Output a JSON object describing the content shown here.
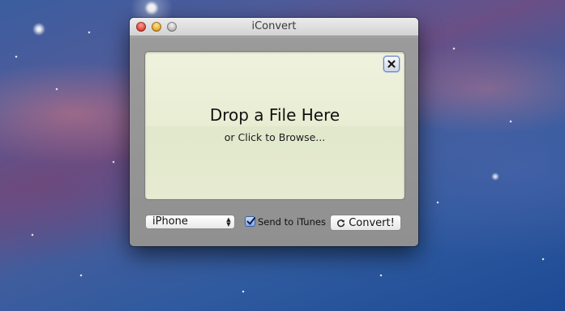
{
  "window": {
    "title": "iConvert",
    "controls": [
      "close",
      "minimize",
      "zoom"
    ]
  },
  "dropzone": {
    "title": "Drop a File Here",
    "subtitle": "or Click to Browse..."
  },
  "device_select": {
    "value": "iPhone"
  },
  "send_to_itunes": {
    "label": "Send to iTunes",
    "checked": true
  },
  "convert_button": {
    "label": "Convert!",
    "icon": "refresh-icon"
  },
  "colors": {
    "dropzone_bg": "#e8edd3",
    "close": "#e0443a",
    "minimize": "#e9a728",
    "zoom": "#b9b9b9",
    "checkbox": "#7fa8e4"
  }
}
